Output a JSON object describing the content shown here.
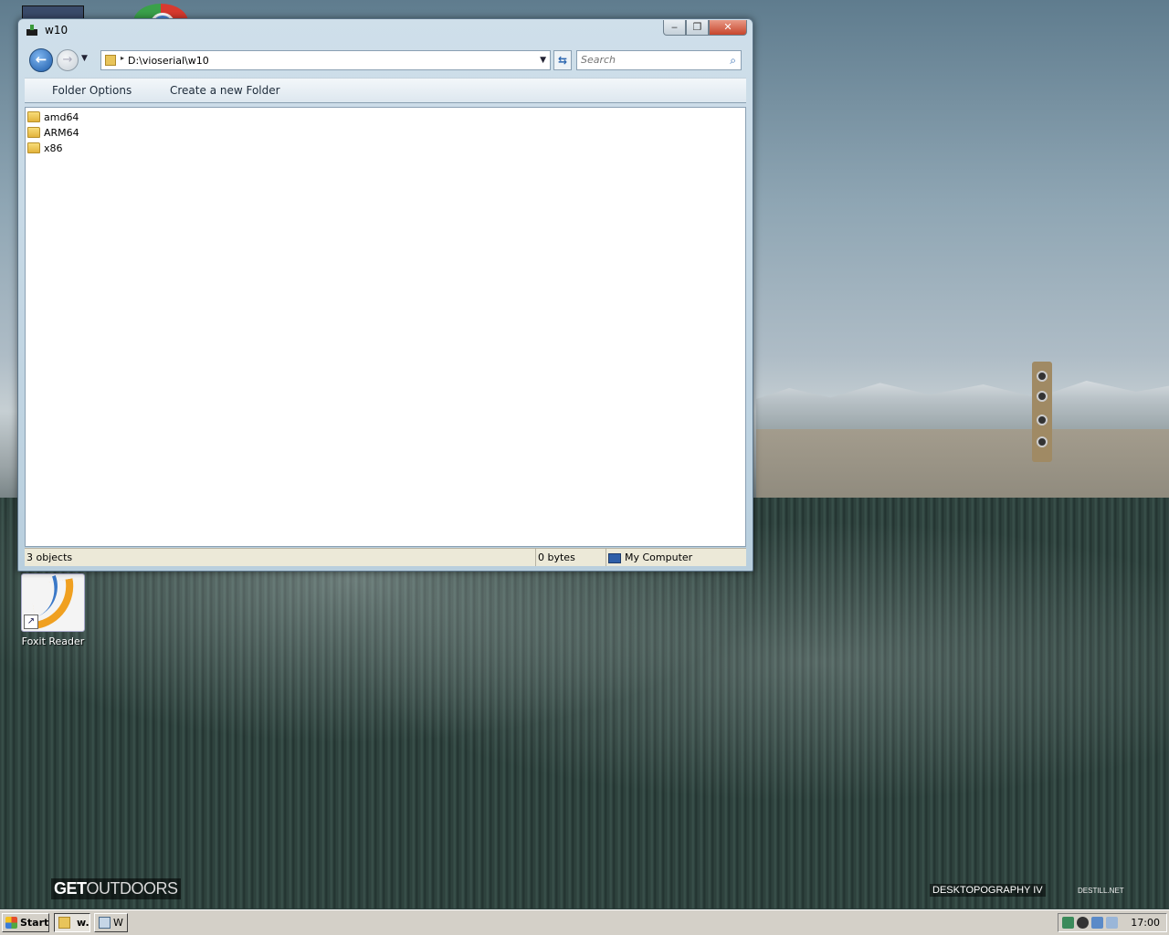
{
  "window": {
    "title": "w10",
    "buttons": {
      "minimize": "‒",
      "maximize": "❐",
      "close": "✕"
    }
  },
  "navbar": {
    "address_path": "D:\\vioserial\\w10",
    "search_placeholder": "Search"
  },
  "commands": {
    "folder_options": "Folder Options",
    "create_folder": "Create a new Folder"
  },
  "files": [
    {
      "name": "amd64",
      "icon": "folder-icon"
    },
    {
      "name": "ARM64",
      "icon": "folder-icon"
    },
    {
      "name": "x86",
      "icon": "folder-icon"
    }
  ],
  "status": {
    "objects": "3 objects",
    "size": "0 bytes",
    "location": "My Computer"
  },
  "desktop": {
    "icon_label": "Foxit Reader",
    "brand_left_a": "GET",
    "brand_left_b": "OUTDOORS",
    "brand_right": "DESKTOPOGRAPHY IV",
    "brand_right_small": "DESTILL.NET"
  },
  "taskbar": {
    "start": "Start",
    "task_active": "w.",
    "task_other": "W",
    "clock": "17:00"
  }
}
